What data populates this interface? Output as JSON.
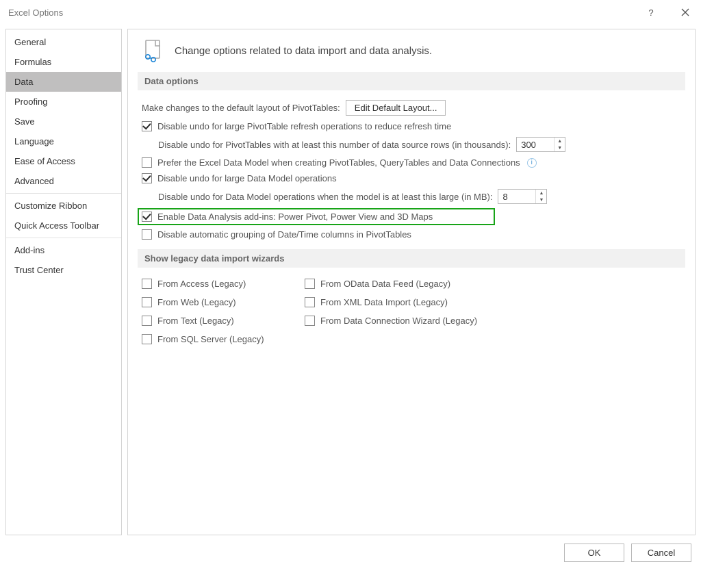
{
  "titlebar": {
    "title": "Excel Options",
    "help": "?",
    "close": "✕"
  },
  "sidebar": {
    "items": [
      {
        "label": "General",
        "selected": false
      },
      {
        "label": "Formulas",
        "selected": false
      },
      {
        "label": "Data",
        "selected": true
      },
      {
        "label": "Proofing",
        "selected": false
      },
      {
        "label": "Save",
        "selected": false
      },
      {
        "label": "Language",
        "selected": false
      },
      {
        "label": "Ease of Access",
        "selected": false
      },
      {
        "label": "Advanced",
        "selected": false
      }
    ],
    "group2": [
      {
        "label": "Customize Ribbon"
      },
      {
        "label": "Quick Access Toolbar"
      }
    ],
    "group3": [
      {
        "label": "Add-ins"
      },
      {
        "label": "Trust Center"
      }
    ]
  },
  "header": {
    "text": "Change options related to data import and data analysis."
  },
  "section_data_options": {
    "title": "Data options",
    "pivot_layout_label": "Make changes to the default layout of PivotTables:",
    "pivot_layout_button": "Edit Default Layout...",
    "cb_disable_undo_large_pivot": {
      "checked": true,
      "label": "Disable undo for large PivotTable refresh operations to reduce refresh time"
    },
    "pivot_rows_label": "Disable undo for PivotTables with at least this number of data source rows (in thousands):",
    "pivot_rows_value": "300",
    "cb_prefer_model": {
      "checked": false,
      "label": "Prefer the Excel Data Model when creating PivotTables, QueryTables and Data Connections"
    },
    "cb_disable_undo_model": {
      "checked": true,
      "label": "Disable undo for large Data Model operations"
    },
    "model_size_label": "Disable undo for Data Model operations when the model is at least this large (in MB):",
    "model_size_value": "8",
    "cb_enable_addins": {
      "checked": true,
      "label": "Enable Data Analysis add-ins: Power Pivot, Power View and 3D Maps"
    },
    "cb_disable_grouping": {
      "checked": false,
      "label": "Disable automatic grouping of Date/Time columns in PivotTables"
    }
  },
  "section_legacy": {
    "title": "Show legacy data import wizards",
    "left": [
      {
        "label": "From Access (Legacy)",
        "checked": false
      },
      {
        "label": "From Web (Legacy)",
        "checked": false
      },
      {
        "label": "From Text (Legacy)",
        "checked": false
      },
      {
        "label": "From SQL Server (Legacy)",
        "checked": false
      }
    ],
    "right": [
      {
        "label": "From OData Data Feed (Legacy)",
        "checked": false
      },
      {
        "label": "From XML Data Import (Legacy)",
        "checked": false
      },
      {
        "label": "From Data Connection Wizard (Legacy)",
        "checked": false
      }
    ]
  },
  "footer": {
    "ok": "OK",
    "cancel": "Cancel"
  }
}
